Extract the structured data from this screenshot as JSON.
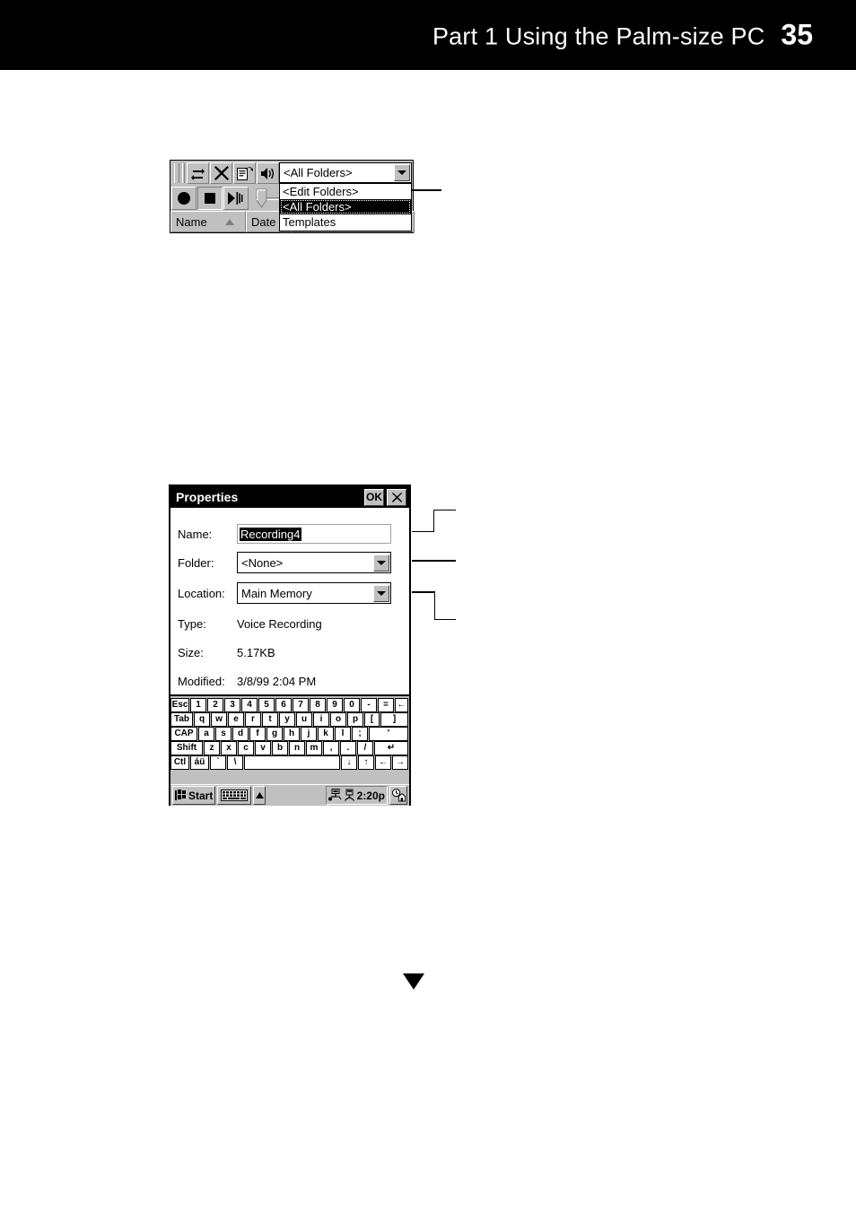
{
  "header": {
    "title": "Part 1  Using the Palm-size PC",
    "page_number": "35"
  },
  "figure_toolbar": {
    "name": "voice-recorder-toolbar",
    "icons": [
      {
        "name": "grip-handle",
        "label": "grip"
      },
      {
        "name": "sync-icon",
        "label": "sync"
      },
      {
        "name": "delete-icon",
        "label": "delete"
      },
      {
        "name": "properties-icon",
        "label": "properties"
      },
      {
        "name": "speaker-icon",
        "label": "speaker"
      }
    ],
    "transport": [
      {
        "name": "record-button",
        "label": "record"
      },
      {
        "name": "stop-button",
        "label": "stop"
      },
      {
        "name": "play-button",
        "label": "play"
      }
    ],
    "combo": {
      "value": "<All Folders>",
      "arrow": "chevron-down-icon"
    },
    "dropdown_items": [
      {
        "label": "<Edit Folders>",
        "selected": false
      },
      {
        "label": "<All Folders>",
        "selected": true
      },
      {
        "label": "Templates",
        "selected": false
      }
    ],
    "columns": [
      {
        "label": "Name",
        "sort": "ascending"
      },
      {
        "label": "Date",
        "sort": ""
      }
    ]
  },
  "figure_properties": {
    "titlebar": {
      "title": "Properties",
      "ok_label": "OK",
      "close_label": "✕"
    },
    "fields": [
      {
        "label": "Name:",
        "value": "Recording4",
        "type": "text",
        "selected": true
      },
      {
        "label": "Folder:",
        "value": "<None>",
        "type": "combo"
      },
      {
        "label": "Location:",
        "value": "Main Memory",
        "type": "combo"
      },
      {
        "label": "Type:",
        "value": "Voice Recording",
        "type": "static"
      },
      {
        "label": "Size:",
        "value": "5.17KB",
        "type": "static"
      },
      {
        "label": "Modified:",
        "value": "3/8/99 2:04 PM",
        "type": "static"
      }
    ],
    "keyboard": {
      "rows": [
        [
          "Esc",
          "1",
          "2",
          "3",
          "4",
          "5",
          "6",
          "7",
          "8",
          "9",
          "0",
          "-",
          "=",
          "←"
        ],
        [
          "Tab",
          "q",
          "w",
          "e",
          "r",
          "t",
          "y",
          "u",
          "i",
          "o",
          "p",
          "[",
          "]"
        ],
        [
          "CAP",
          "a",
          "s",
          "d",
          "f",
          "g",
          "h",
          "j",
          "k",
          "l",
          ";",
          "'"
        ],
        [
          "Shift",
          "z",
          "x",
          "c",
          "v",
          "b",
          "n",
          "m",
          ",",
          ".",
          "/",
          "↵"
        ],
        [
          "Ctl",
          "áü",
          "`",
          "\\",
          "",
          "↓",
          "↑",
          "←",
          "→"
        ]
      ]
    },
    "taskbar": {
      "start_label": "Start",
      "start_icon": "windows-flag-icon",
      "keyboard_icon": "keyboard-icon",
      "keyboard_arrow": "chevron-up-icon",
      "tray_icons": [
        "connection-icon",
        "power-plug-icon"
      ],
      "time": "2:20p",
      "right_icon": "home-clock-icon"
    }
  },
  "annotations": {
    "continuation_marker": "down-triangle-icon",
    "callouts": [
      {
        "name": "callout-folder-dropdown-list"
      },
      {
        "name": "callout-name-field"
      },
      {
        "name": "callout-folder-combo"
      },
      {
        "name": "callout-location-combo"
      }
    ]
  },
  "colors": {
    "header_bg": "#000000",
    "header_fg": "#ffffff",
    "device_chrome": "#c0c0c0",
    "field_bg": "#ffffff",
    "selection_bg": "#000000",
    "selection_fg": "#ffffff"
  }
}
